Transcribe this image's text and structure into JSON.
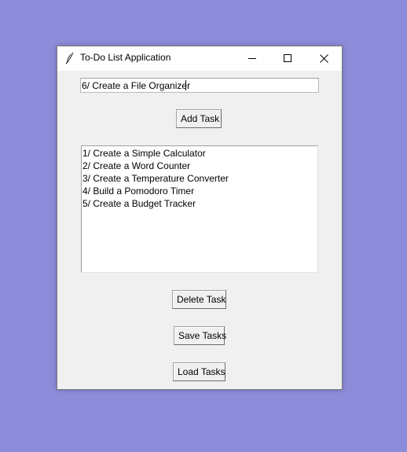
{
  "window": {
    "title": "To-Do List Application",
    "icon": "feather-icon",
    "controls": [
      "minimize-icon",
      "maximize-icon",
      "close-icon"
    ]
  },
  "task_entry": {
    "value": "6/ Create a File Organizer"
  },
  "buttons": {
    "add": "Add Task",
    "delete": "Delete Task",
    "save": "Save Tasks",
    "load": "Load Tasks"
  },
  "tasks": [
    "1/ Create a Simple Calculator",
    "2/ Create a Word Counter",
    "3/ Create a Temperature Converter",
    "4/ Build a Pomodoro Timer",
    "5/ Create a Budget Tracker"
  ],
  "colors": {
    "desktop": "#8c8cda",
    "window_bg": "#f0f0f0",
    "titlebar_bg": "#ffffff"
  }
}
